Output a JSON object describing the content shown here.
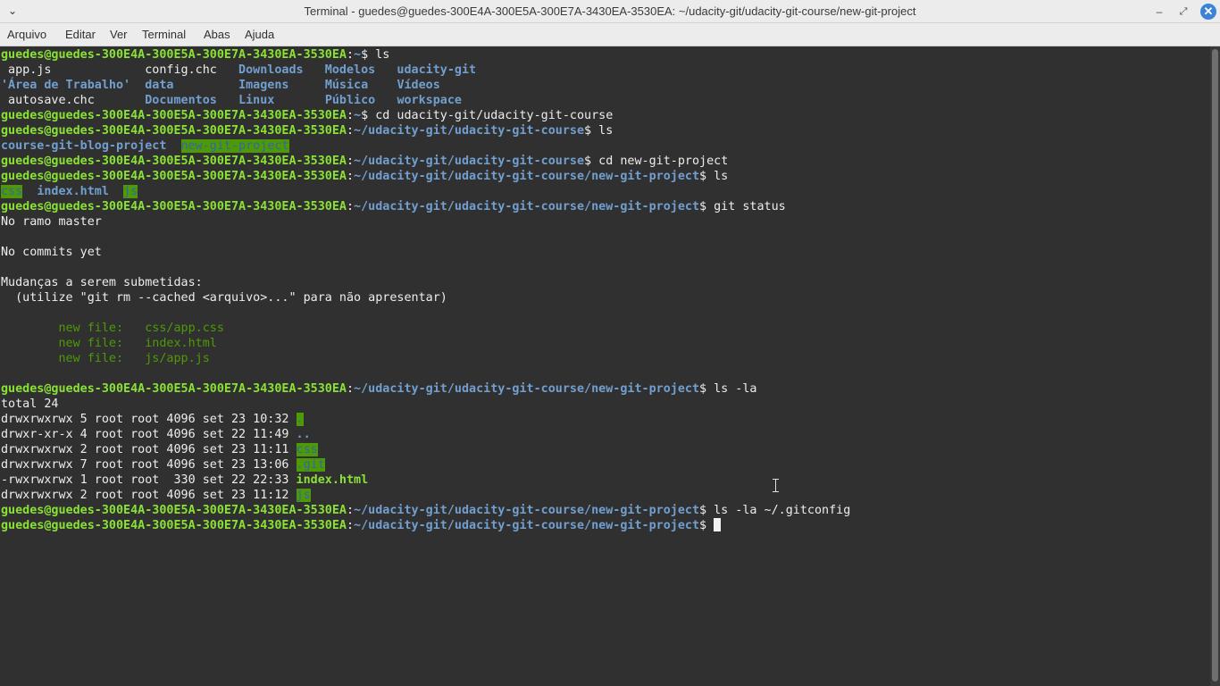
{
  "window": {
    "title": "Terminal - guedes@guedes-300E4A-300E5A-300E7A-3430EA-3530EA: ~/udacity-git/udacity-git-course/new-git-project",
    "menu_glyph": "⌄",
    "minimize_glyph": "‒",
    "maximize_glyph": "⤢",
    "close_glyph": "✕"
  },
  "menubar": [
    "Arquivo",
    "Editar",
    "Ver",
    "Terminal",
    "Abas",
    "Ajuda"
  ],
  "colors": {
    "prompt_user": "#8ae234",
    "prompt_path": "#729fcf",
    "highlight_bg": "#4e9a06",
    "terminal_bg": "#303030"
  },
  "terminal": {
    "prompt_user": "guedes@guedes-300E4A-300E5A-300E7A-3430EA-3530EA",
    "lines": [
      [
        {
          "t": "guedes@guedes-300E4A-300E5A-300E7A-3430EA-3530EA",
          "c": "pu"
        },
        {
          "t": ":",
          "c": ""
        },
        {
          "t": "~",
          "c": "pp"
        },
        {
          "t": "$ ls",
          "c": ""
        }
      ],
      [
        {
          "t": " app.js             config.chc   ",
          "c": ""
        },
        {
          "t": "Downloads",
          "c": "dir"
        },
        {
          "t": "   ",
          "c": ""
        },
        {
          "t": "Modelos",
          "c": "dir"
        },
        {
          "t": "   ",
          "c": ""
        },
        {
          "t": "udacity-git",
          "c": "dir"
        }
      ],
      [
        {
          "t": "'Área de Trabalho'",
          "c": "dir"
        },
        {
          "t": "  ",
          "c": ""
        },
        {
          "t": "data",
          "c": "dir"
        },
        {
          "t": "         ",
          "c": ""
        },
        {
          "t": "Imagens",
          "c": "dir"
        },
        {
          "t": "     ",
          "c": ""
        },
        {
          "t": "Música",
          "c": "dir"
        },
        {
          "t": "    ",
          "c": ""
        },
        {
          "t": "Vídeos",
          "c": "dir"
        }
      ],
      [
        {
          "t": " autosave.chc       ",
          "c": ""
        },
        {
          "t": "Documentos",
          "c": "dir"
        },
        {
          "t": "   ",
          "c": ""
        },
        {
          "t": "Linux",
          "c": "dir"
        },
        {
          "t": "       ",
          "c": ""
        },
        {
          "t": "Público",
          "c": "dir"
        },
        {
          "t": "   ",
          "c": ""
        },
        {
          "t": "workspace",
          "c": "dir"
        }
      ],
      [
        {
          "t": "guedes@guedes-300E4A-300E5A-300E7A-3430EA-3530EA",
          "c": "pu"
        },
        {
          "t": ":",
          "c": ""
        },
        {
          "t": "~",
          "c": "pp"
        },
        {
          "t": "$ cd udacity-git/udacity-git-course",
          "c": ""
        }
      ],
      [
        {
          "t": "guedes@guedes-300E4A-300E5A-300E7A-3430EA-3530EA",
          "c": "pu"
        },
        {
          "t": ":",
          "c": ""
        },
        {
          "t": "~/udacity-git/udacity-git-course",
          "c": "pp"
        },
        {
          "t": "$ ls",
          "c": ""
        }
      ],
      [
        {
          "t": "course-git-blog-project",
          "c": "dir"
        },
        {
          "t": "  ",
          "c": ""
        },
        {
          "t": "new-git-project",
          "c": "hl"
        }
      ],
      [
        {
          "t": "guedes@guedes-300E4A-300E5A-300E7A-3430EA-3530EA",
          "c": "pu"
        },
        {
          "t": ":",
          "c": ""
        },
        {
          "t": "~/udacity-git/udacity-git-course",
          "c": "pp"
        },
        {
          "t": "$ cd new-git-project",
          "c": ""
        }
      ],
      [
        {
          "t": "guedes@guedes-300E4A-300E5A-300E7A-3430EA-3530EA",
          "c": "pu"
        },
        {
          "t": ":",
          "c": ""
        },
        {
          "t": "~/udacity-git/udacity-git-course/new-git-project",
          "c": "pp"
        },
        {
          "t": "$ ls",
          "c": ""
        }
      ],
      [
        {
          "t": "css",
          "c": "hl"
        },
        {
          "t": "  ",
          "c": ""
        },
        {
          "t": "index.html",
          "c": "dir"
        },
        {
          "t": "  ",
          "c": ""
        },
        {
          "t": "js",
          "c": "hl"
        }
      ],
      [
        {
          "t": "guedes@guedes-300E4A-300E5A-300E7A-3430EA-3530EA",
          "c": "pu"
        },
        {
          "t": ":",
          "c": ""
        },
        {
          "t": "~/udacity-git/udacity-git-course/new-git-project",
          "c": "pp"
        },
        {
          "t": "$ git status",
          "c": ""
        }
      ],
      [
        {
          "t": "No ramo master",
          "c": ""
        }
      ],
      [],
      [
        {
          "t": "No commits yet",
          "c": ""
        }
      ],
      [],
      [
        {
          "t": "Mudanças a serem submetidas:",
          "c": ""
        }
      ],
      [
        {
          "t": "  (utilize \"git rm --cached <arquivo>...\" para não apresentar)",
          "c": ""
        }
      ],
      [],
      [
        {
          "t": "        new file:   css/app.css",
          "c": "green"
        }
      ],
      [
        {
          "t": "        new file:   index.html",
          "c": "green"
        }
      ],
      [
        {
          "t": "        new file:   js/app.js",
          "c": "green"
        }
      ],
      [],
      [
        {
          "t": "guedes@guedes-300E4A-300E5A-300E7A-3430EA-3530EA",
          "c": "pu"
        },
        {
          "t": ":",
          "c": ""
        },
        {
          "t": "~/udacity-git/udacity-git-course/new-git-project",
          "c": "pp"
        },
        {
          "t": "$ ls -la",
          "c": ""
        }
      ],
      [
        {
          "t": "total 24",
          "c": ""
        }
      ],
      [
        {
          "t": "drwxrwxrwx 5 root root 4096 set 23 10:32 ",
          "c": ""
        },
        {
          "t": ".",
          "c": "hl"
        }
      ],
      [
        {
          "t": "drwxr-xr-x 4 root root 4096 set 22 11:49 ",
          "c": ""
        },
        {
          "t": "..",
          "c": "dir"
        }
      ],
      [
        {
          "t": "drwxrwxrwx 2 root root 4096 set 23 11:11 ",
          "c": ""
        },
        {
          "t": "css",
          "c": "hl"
        }
      ],
      [
        {
          "t": "drwxrwxrwx 7 root root 4096 set 23 13:06 ",
          "c": ""
        },
        {
          "t": ".git",
          "c": "hl"
        }
      ],
      [
        {
          "t": "-rwxrwxrwx 1 root root  330 set 22 22:33 ",
          "c": ""
        },
        {
          "t": "index.html",
          "c": "gbold"
        }
      ],
      [
        {
          "t": "drwxrwxrwx 2 root root 4096 set 23 11:12 ",
          "c": ""
        },
        {
          "t": "js",
          "c": "hl"
        }
      ],
      [
        {
          "t": "guedes@guedes-300E4A-300E5A-300E7A-3430EA-3530EA",
          "c": "pu"
        },
        {
          "t": ":",
          "c": ""
        },
        {
          "t": "~/udacity-git/udacity-git-course/new-git-project",
          "c": "pp"
        },
        {
          "t": "$ ls -la ~/.gitconfig",
          "c": ""
        }
      ],
      [
        {
          "t": "guedes@guedes-300E4A-300E5A-300E7A-3430EA-3530EA",
          "c": "pu"
        },
        {
          "t": ":",
          "c": ""
        },
        {
          "t": "~/udacity-git/udacity-git-course/new-git-project",
          "c": "pp"
        },
        {
          "t": "$ ",
          "c": ""
        },
        {
          "t": "",
          "c": "cursor"
        }
      ]
    ]
  }
}
